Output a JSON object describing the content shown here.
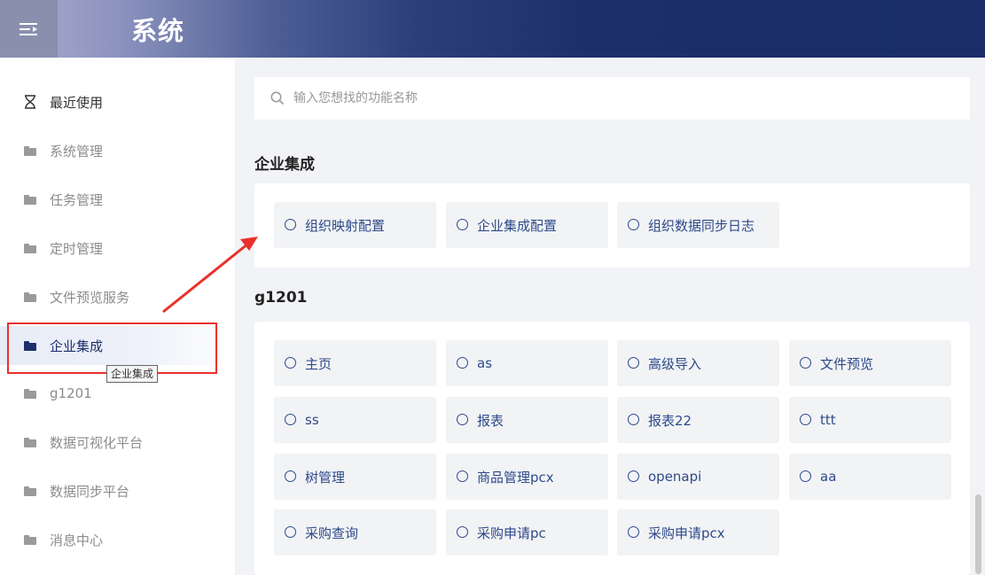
{
  "header": {
    "title": "系统",
    "menu_icon": "menu-fold-icon"
  },
  "sidebar": {
    "items": [
      {
        "label": "最近使用",
        "icon": "hourglass-icon"
      },
      {
        "label": "系统管理",
        "icon": "folder-icon"
      },
      {
        "label": "任务管理",
        "icon": "folder-icon"
      },
      {
        "label": "定时管理",
        "icon": "folder-icon"
      },
      {
        "label": "文件预览服务",
        "icon": "folder-icon"
      },
      {
        "label": "企业集成",
        "icon": "folder-icon",
        "active": true
      },
      {
        "label": "g1201",
        "icon": "folder-icon"
      },
      {
        "label": "数据可视化平台",
        "icon": "folder-icon"
      },
      {
        "label": "数据同步平台",
        "icon": "folder-icon"
      },
      {
        "label": "消息中心",
        "icon": "folder-icon"
      }
    ],
    "tooltip": "企业集成"
  },
  "search": {
    "placeholder": "输入您想找的功能名称",
    "value": ""
  },
  "sections": [
    {
      "title": "企业集成",
      "items": [
        "组织映射配置",
        "企业集成配置",
        "组织数据同步日志"
      ]
    },
    {
      "title": "g1201",
      "items": [
        "主页",
        "as",
        "高级导入",
        "文件预览",
        "ss",
        "报表",
        "报表22",
        "ttt",
        "树管理",
        "商品管理pcx",
        "openapi",
        "aa",
        "采购查询",
        "采购申请pc",
        "采购申请pcx"
      ]
    }
  ],
  "colors": {
    "accent": "#1c2f6b",
    "card_text": "#2d4a8a",
    "highlight": "#e9312c"
  }
}
